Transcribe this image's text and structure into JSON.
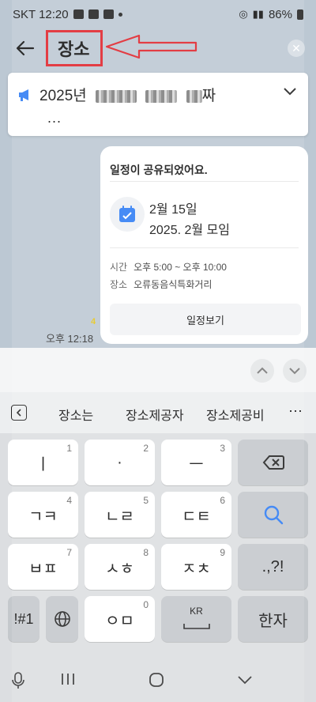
{
  "status_bar": {
    "carrier_time": "SKT 12:20",
    "battery": "86%"
  },
  "header": {
    "title": "장소"
  },
  "notice": {
    "year_text": "2025년",
    "suffix": "짜",
    "more": "..."
  },
  "event_card": {
    "heading": "일정이 공유되었어요.",
    "date": "2월 15일",
    "event_name": "2025. 2월 모임",
    "time_label": "시간",
    "time_value": "오후 5:00 ~ 오후 10:00",
    "place_label": "장소",
    "place_value": "오류동음식특화거리",
    "button_label": "일정보기"
  },
  "message": {
    "unread_count": "4",
    "time": "오후 12:18"
  },
  "suggestions": [
    "장소는",
    "장소제공자",
    "장소제공비"
  ],
  "keyboard": {
    "row1": [
      {
        "label": "ㅣ",
        "num": "1"
      },
      {
        "label": "·",
        "num": "2"
      },
      {
        "label": "ㅡ",
        "num": "3"
      }
    ],
    "row2": [
      {
        "label": "ㄱㅋ",
        "num": "4"
      },
      {
        "label": "ㄴㄹ",
        "num": "5"
      },
      {
        "label": "ㄷㅌ",
        "num": "6"
      }
    ],
    "row3": [
      {
        "label": "ㅂㅍ",
        "num": "7"
      },
      {
        "label": "ㅅㅎ",
        "num": "8"
      },
      {
        "label": "ㅈㅊ",
        "num": "9"
      }
    ],
    "row4": [
      {
        "label": "ㅇㅁ",
        "num": "0"
      }
    ],
    "punct": ".,?!",
    "symbols": "!#1",
    "lang": "KR",
    "hanja": "한자"
  },
  "colors": {
    "accent_blue": "#2d7bf4",
    "highlight_red": "#e0232b",
    "chat_bg": "#bcc8d3"
  }
}
